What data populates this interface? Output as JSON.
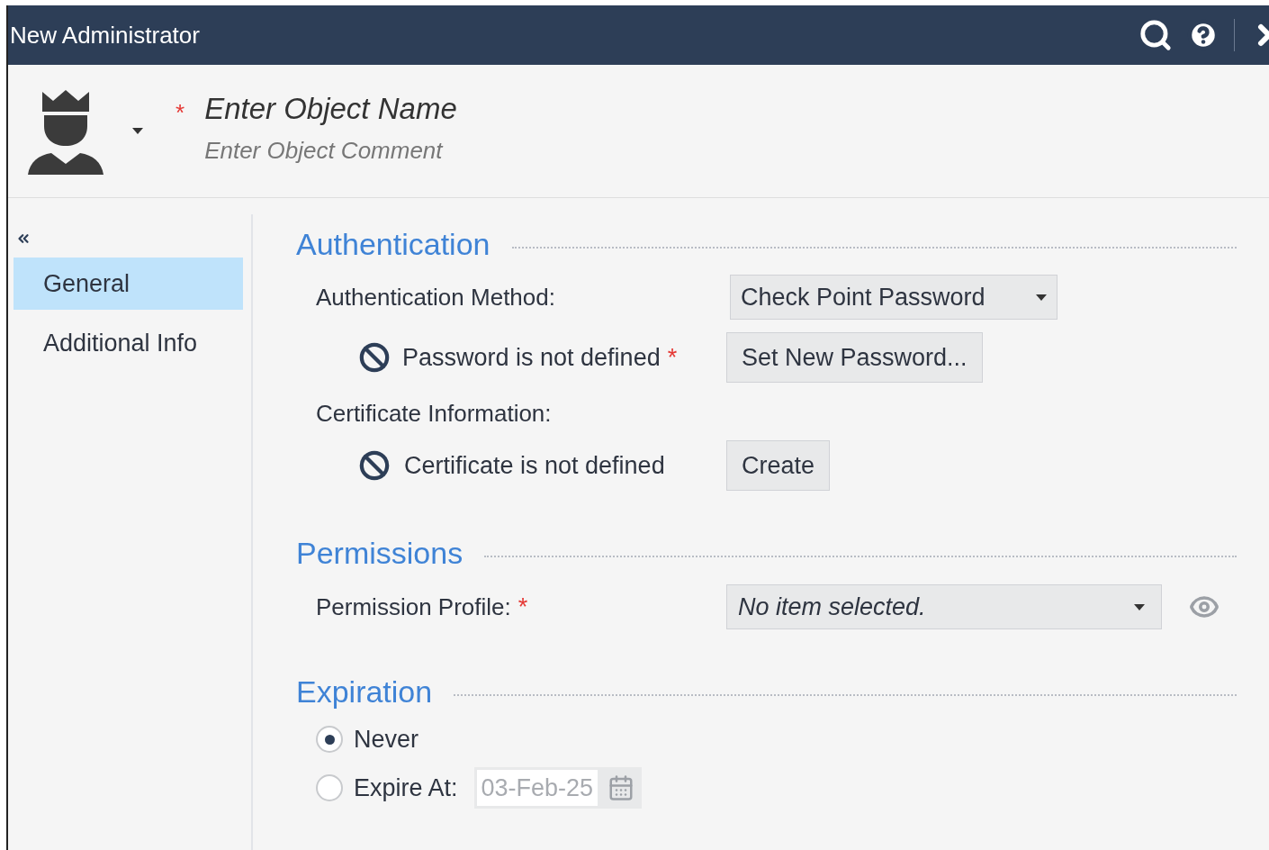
{
  "window": {
    "title": "New Administrator"
  },
  "header": {
    "name_placeholder": "Enter Object Name",
    "comment_placeholder": "Enter Object Comment",
    "required_mark": "*"
  },
  "sidebar": {
    "items": [
      {
        "label": "General",
        "selected": true
      },
      {
        "label": "Additional Info",
        "selected": false
      }
    ]
  },
  "authentication": {
    "title": "Authentication",
    "method_label": "Authentication Method:",
    "method_value": "Check Point Password",
    "password_status": "Password is not defined",
    "password_required_mark": "*",
    "password_button": "Set New Password...",
    "certificate_label": "Certificate Information:",
    "certificate_status": "Certificate is not defined",
    "certificate_button": "Create"
  },
  "permissions": {
    "title": "Permissions",
    "profile_label": "Permission Profile:",
    "required_mark": "*",
    "profile_value": "No item selected."
  },
  "expiration": {
    "title": "Expiration",
    "options": [
      {
        "label": "Never",
        "selected": true
      },
      {
        "label": "Expire At:",
        "selected": false
      }
    ],
    "date": {
      "value": "03-Feb-25",
      "disabled": true
    }
  }
}
